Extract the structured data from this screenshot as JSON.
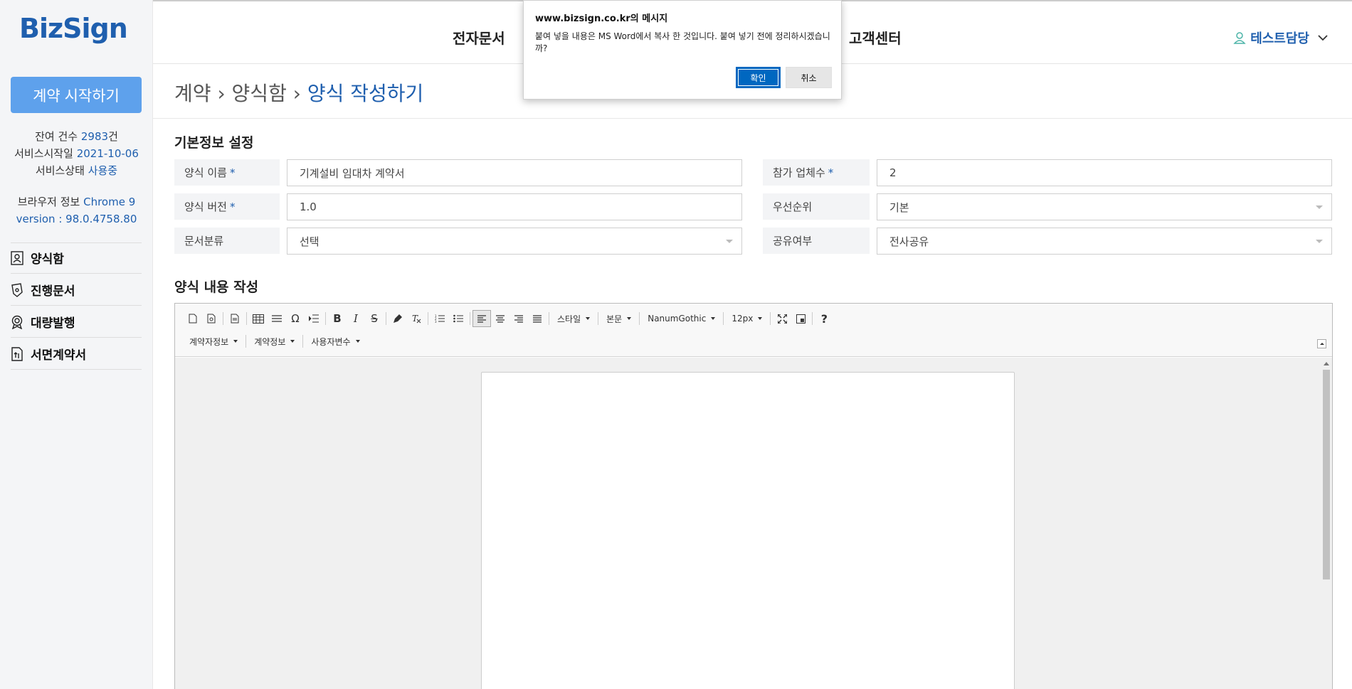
{
  "sidebar": {
    "logo": "BizSign",
    "start_button": "계약 시작하기",
    "remaining_label": "잔여 건수",
    "remaining_value": "2983",
    "remaining_unit": "건",
    "service_start_label": "서비스시작일",
    "service_start_value": "2021-10-06",
    "service_status_label": "서비스상태",
    "service_status_value": "사용중",
    "browser_label": "브라우저 정보",
    "browser_value": "Chrome 9",
    "version_label": "version",
    "version_value": ": 98.0.4758.80",
    "nav": [
      {
        "label": "양식함",
        "icon": "user-card-icon"
      },
      {
        "label": "진행문서",
        "icon": "pen-document-icon"
      },
      {
        "label": "대량발행",
        "icon": "award-badge-icon"
      },
      {
        "label": "서면계약서",
        "icon": "upload-document-icon"
      }
    ]
  },
  "header": {
    "menu_left": "전자문서",
    "menu_right": "고객센터",
    "user": "테스트담당"
  },
  "breadcrumb": {
    "part1": "계약",
    "sep": "›",
    "part2": "양식함",
    "current": "양식 작성하기"
  },
  "basic_info": {
    "title": "기본정보 설정",
    "form_name_label": "양식 이름",
    "form_name_value": "기계설비 임대차 계약서",
    "participants_label": "참가 업체수",
    "participants_value": "2",
    "version_label": "양식 버전",
    "version_value": "1.0",
    "priority_label": "우선순위",
    "priority_value": "기본",
    "category_label": "문서분류",
    "category_value": "선택",
    "share_label": "공유여부",
    "share_value": "전사공유",
    "required_mark": "*"
  },
  "content": {
    "title": "양식 내용 작성"
  },
  "editor": {
    "style_combo": "스타일",
    "format_combo": "본문",
    "font_combo": "NanumGothic",
    "size_combo": "12px",
    "bold": "B",
    "italic": "I",
    "strike": "S",
    "omega": "Ω",
    "help": "?",
    "contractor_combo": "계약자정보",
    "contract_combo": "계약정보",
    "user_var_combo": "사용자변수"
  },
  "dialog": {
    "title": "www.bizsign.co.kr의 메시지",
    "message": "붙여 넣을 내용은 MS Word에서 복사 한 것입니다. 붙여 넣기 전에 정리하시겠습니까?",
    "ok": "확인",
    "cancel": "취소"
  },
  "colors": {
    "brand": "#1f5fae",
    "start_button": "#5ea1ec",
    "dialog_ok": "#0067c0"
  }
}
